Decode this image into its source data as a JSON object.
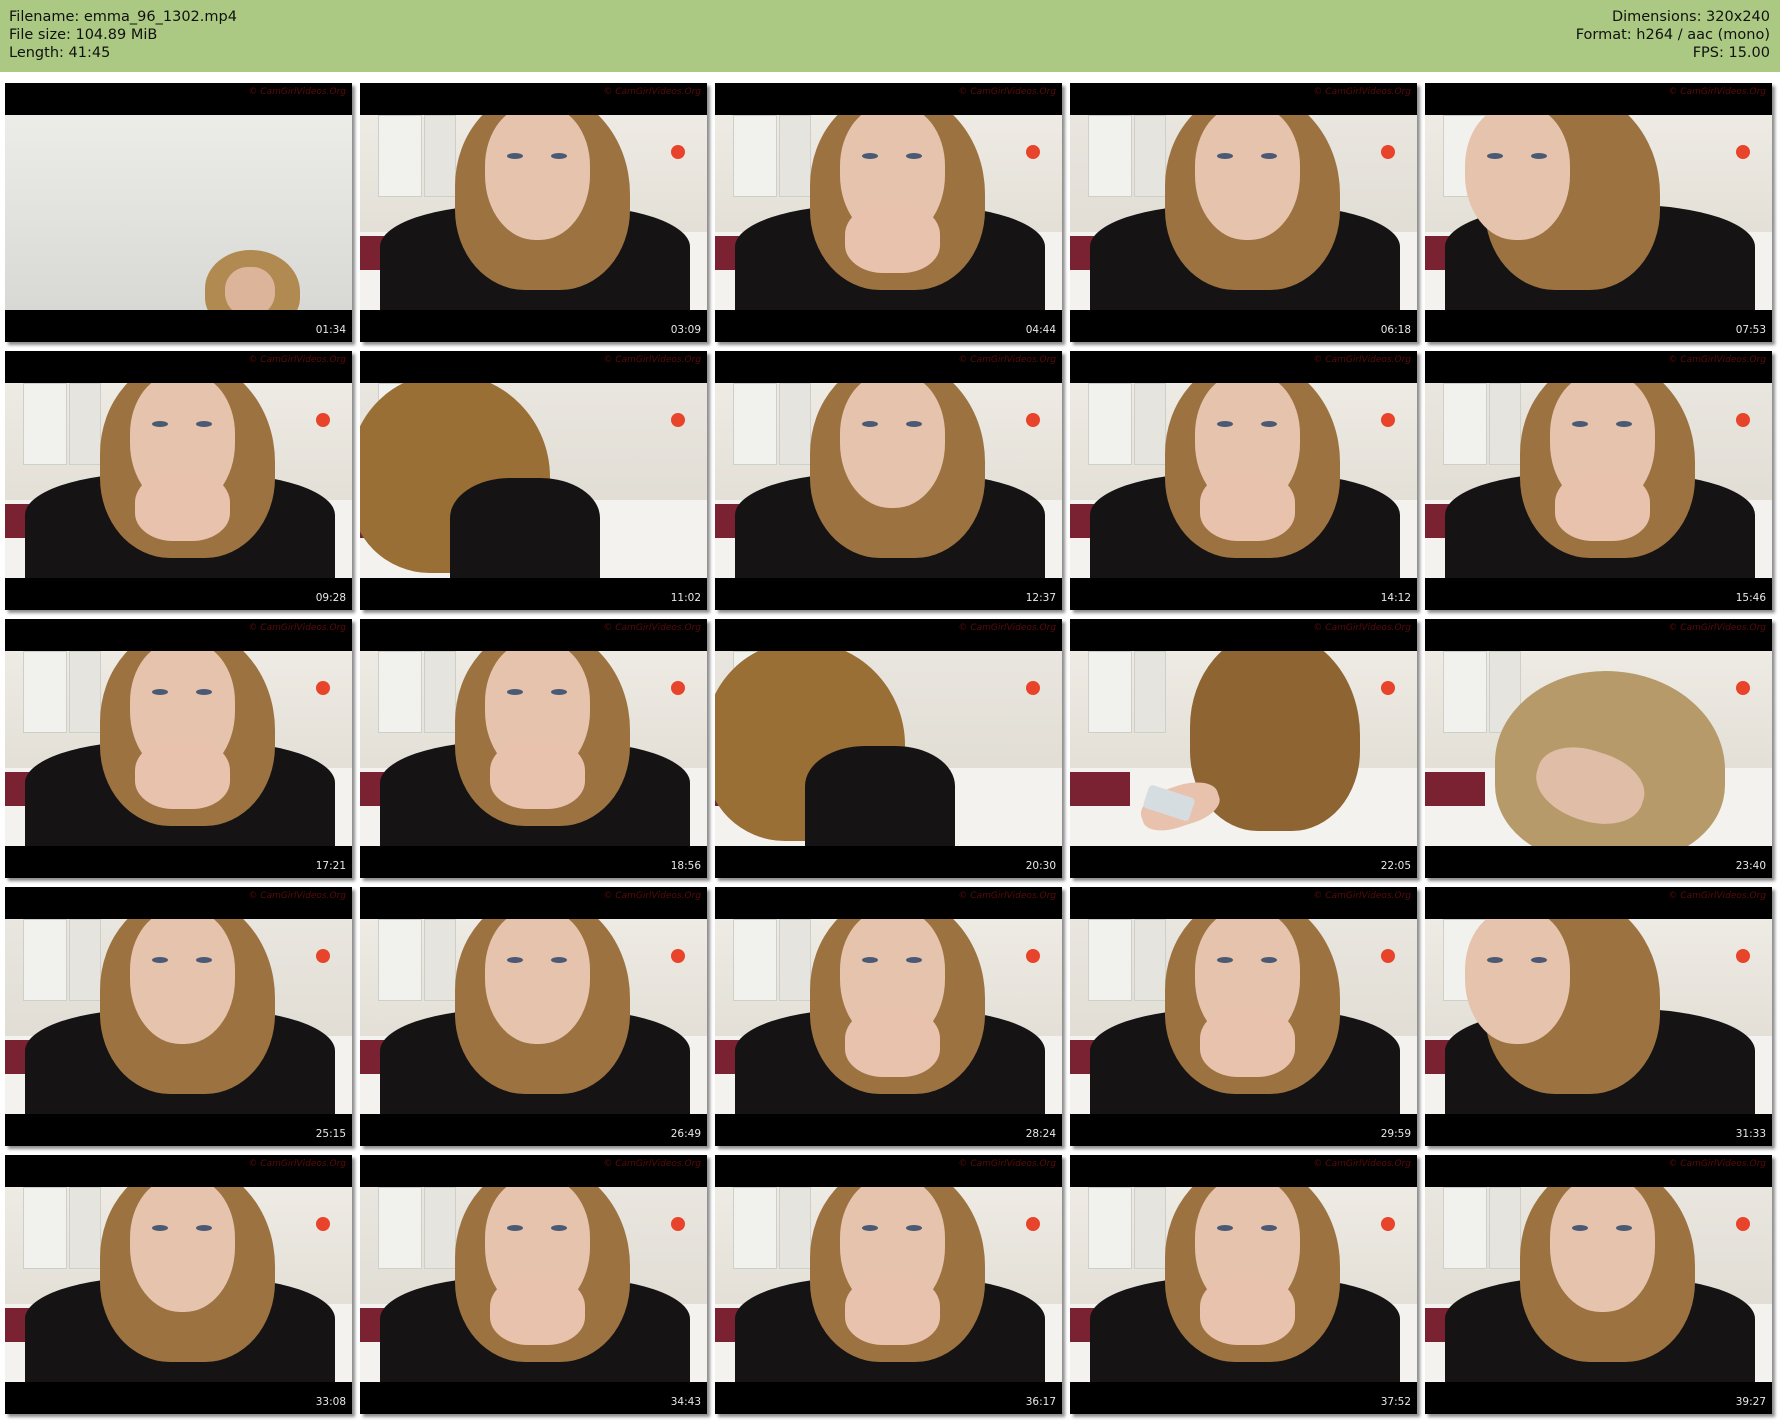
{
  "header": {
    "filename_label": "Filename: emma_96_1302.mp4",
    "filesize_label": "File size: 104.89 MiB",
    "length_label": "Length: 41:45",
    "dimensions_label": "Dimensions: 320x240",
    "format_label": "Format: h264 / aac (mono)",
    "fps_label": "FPS: 15.00"
  },
  "watermark": "© CamGirlVideos.Org",
  "thumbnails": [
    {
      "timestamp": "01:34",
      "scene": "empty"
    },
    {
      "timestamp": "03:09",
      "scene": "lean"
    },
    {
      "timestamp": "04:44",
      "scene": "hand"
    },
    {
      "timestamp": "06:18",
      "scene": "face"
    },
    {
      "timestamp": "07:53",
      "scene": "side"
    },
    {
      "timestamp": "09:28",
      "scene": "hand"
    },
    {
      "timestamp": "11:02",
      "scene": "away"
    },
    {
      "timestamp": "12:37",
      "scene": "face"
    },
    {
      "timestamp": "14:12",
      "scene": "hand"
    },
    {
      "timestamp": "15:46",
      "scene": "hand"
    },
    {
      "timestamp": "17:21",
      "scene": "hand"
    },
    {
      "timestamp": "18:56",
      "scene": "hand"
    },
    {
      "timestamp": "20:30",
      "scene": "away"
    },
    {
      "timestamp": "22:05",
      "scene": "phone"
    },
    {
      "timestamp": "23:40",
      "scene": "down"
    },
    {
      "timestamp": "25:15",
      "scene": "face"
    },
    {
      "timestamp": "26:49",
      "scene": "face"
    },
    {
      "timestamp": "28:24",
      "scene": "hand"
    },
    {
      "timestamp": "29:59",
      "scene": "hand"
    },
    {
      "timestamp": "31:33",
      "scene": "side"
    },
    {
      "timestamp": "33:08",
      "scene": "face"
    },
    {
      "timestamp": "34:43",
      "scene": "hand"
    },
    {
      "timestamp": "36:17",
      "scene": "hand"
    },
    {
      "timestamp": "37:52",
      "scene": "hand"
    },
    {
      "timestamp": "39:27",
      "scene": "face"
    }
  ]
}
